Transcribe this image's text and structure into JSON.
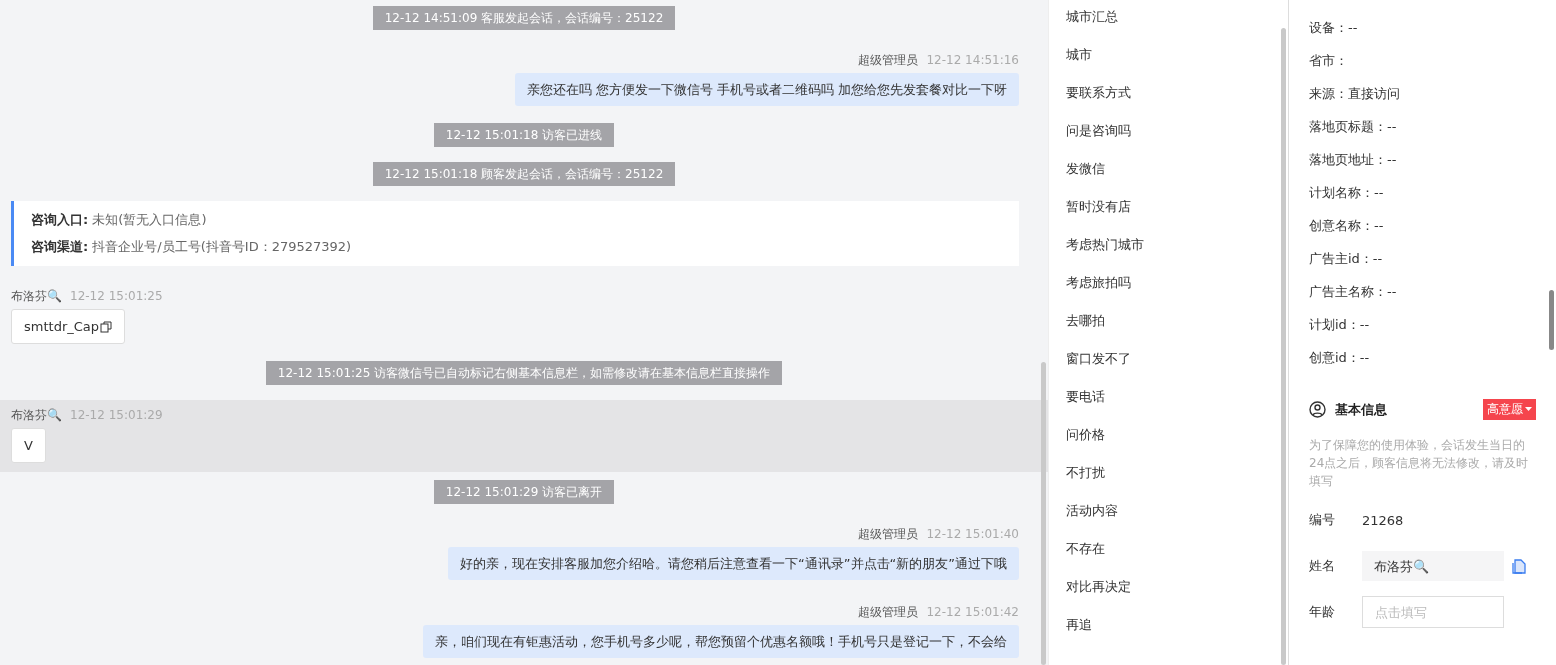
{
  "chat": {
    "messages": [
      {
        "kind": "system",
        "text": "12-12 14:51:09 客服发起会话，会话编号：25122"
      },
      {
        "kind": "agent",
        "sender": "超级管理员",
        "time": "12-12 14:51:16",
        "text": "亲您还在吗 您方便发一下微信号 手机号或者二维码吗 加您给您先发套餐对比一下呀"
      },
      {
        "kind": "system",
        "text": "12-12 15:01:18 访客已进线"
      },
      {
        "kind": "system",
        "text": "12-12 15:01:18 顾客发起会话，会话编号：25122"
      },
      {
        "kind": "info",
        "lines": [
          {
            "label": "咨询入口:",
            "value": "未知(暂无入口信息)"
          },
          {
            "label": "咨询渠道:",
            "value": "抖音企业号/员工号(抖音号ID：279527392)"
          }
        ]
      },
      {
        "kind": "visitor",
        "sender": "布洛芬🔍",
        "time": "12-12 15:01:25",
        "text": "smttdr_Cap",
        "copyable": true,
        "selected": false
      },
      {
        "kind": "system",
        "text": "12-12 15:01:25 访客微信号已自动标记右侧基本信息栏，如需修改请在基本信息栏直接操作"
      },
      {
        "kind": "visitor",
        "sender": "布洛芬🔍",
        "time": "12-12 15:01:29",
        "text": "V",
        "copyable": false,
        "selected": true
      },
      {
        "kind": "system",
        "text": "12-12 15:01:29 访客已离开"
      },
      {
        "kind": "agent",
        "sender": "超级管理员",
        "time": "12-12 15:01:40",
        "text": "好的亲，现在安排客服加您介绍哈。请您稍后注意查看一下“通讯录”并点击“新的朋友”通过下哦"
      },
      {
        "kind": "agent",
        "sender": "超级管理员",
        "time": "12-12 15:01:42",
        "text": "亲，咱们现在有钜惠活动，您手机号多少呢，帮您预留个优惠名额哦！手机号只是登记一下，不会给"
      }
    ]
  },
  "quick_replies": [
    "城市汇总",
    "城市",
    "要联系方式",
    "问是咨询吗",
    "发微信",
    "暂时没有店",
    "考虑热门城市",
    "考虑旅拍吗",
    "去哪拍",
    "窗口发不了",
    "要电话",
    "问价格",
    "不打扰",
    "活动内容",
    "不存在",
    "对比再决定",
    "再追"
  ],
  "visitor_details": [
    "设备：--",
    "省市：",
    "来源：直接访问",
    "落地页标题：--",
    "落地页地址：--",
    "计划名称：--",
    "创意名称：--",
    "广告主id：--",
    "广告主名称：--",
    "计划id：--",
    "创意id：--"
  ],
  "basic_info": {
    "title": "基本信息",
    "intent_tag": "高意愿",
    "notice": "为了保障您的使用体验，会话发生当日的24点之后，顾客信息将无法修改，请及时填写",
    "fields": [
      {
        "kind": "text",
        "label": "编号",
        "value": "21268"
      },
      {
        "kind": "filled",
        "label": "姓名",
        "value": "布洛芬🔍"
      },
      {
        "kind": "empty",
        "label": "年龄",
        "placeholder": "点击填写"
      }
    ]
  }
}
